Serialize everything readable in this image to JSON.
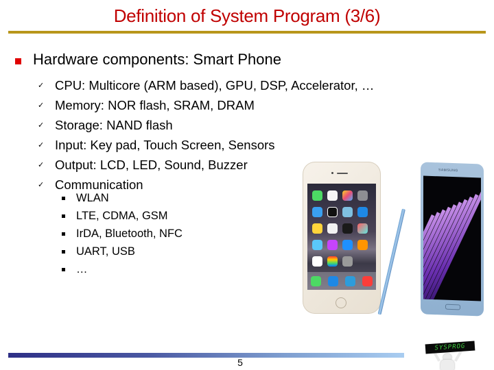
{
  "slide": {
    "title": "Definition of System Program (3/6)",
    "page_number": "5",
    "colors": {
      "title": "#c00000",
      "title_rule": "#b8961b",
      "bullet": "#e00000",
      "footer_gradient_start": "#2e2f86",
      "footer_gradient_end": "#a9cdf1"
    }
  },
  "content": {
    "heading": "Hardware components: Smart Phone",
    "items": [
      {
        "icon": "checkmark-icon",
        "text": "CPU: Multicore (ARM based), GPU, DSP, Accelerator, …"
      },
      {
        "icon": "checkmark-icon",
        "text": "Memory: NOR flash, SRAM, DRAM"
      },
      {
        "icon": "checkmark-icon",
        "text": "Storage: NAND flash"
      },
      {
        "icon": "checkmark-icon",
        "text": "Input: Key pad, Touch Screen, Sensors"
      },
      {
        "icon": "checkmark-icon",
        "text": "Output: LCD, LED, Sound, Buzzer"
      },
      {
        "icon": "checkmark-icon",
        "text": "Communication"
      }
    ],
    "sub_items": [
      {
        "icon": "square-bullet-icon",
        "text": "WLAN"
      },
      {
        "icon": "square-bullet-icon",
        "text": "LTE, CDMA, GSM"
      },
      {
        "icon": "square-bullet-icon",
        "text": "IrDA, Bluetooth, NFC"
      },
      {
        "icon": "square-bullet-icon",
        "text": "UART, USB"
      },
      {
        "icon": "square-bullet-icon",
        "text": "…"
      }
    ]
  },
  "images": {
    "iphone": {
      "label": "iPhone"
    },
    "galaxy_note": {
      "brand": "SAMSUNG"
    },
    "logo": {
      "sign_text": "SYSPROG"
    }
  }
}
